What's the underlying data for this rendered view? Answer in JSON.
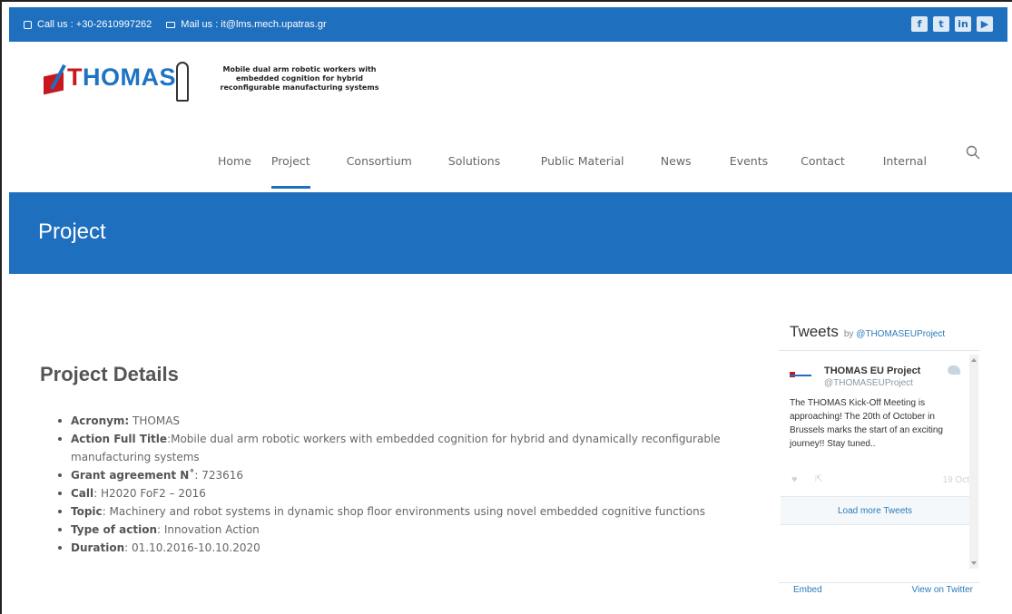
{
  "topbar": {
    "phone": "Call us : +30-2610997262",
    "mail": "Mail us : it@lms.mech.upatras.gr",
    "social": [
      "facebook-icon",
      "twitter-icon",
      "linkedin-icon",
      "youtube-icon"
    ]
  },
  "logo": {
    "word": "HOMAS",
    "tagline": "Mobile dual arm robotic workers with embedded cognition for hybrid reconfigurable manufacturing systems"
  },
  "nav": {
    "items": [
      "Home",
      "Project",
      "Consortium",
      "Solutions",
      "Public Material",
      "News",
      "Events",
      "Contact",
      "Internal"
    ],
    "active": "Project"
  },
  "page": {
    "title": "Project",
    "details_heading": "Project Details"
  },
  "details": [
    {
      "label": "Acronym:",
      "value": " THOMAS"
    },
    {
      "label": "Action Full Title",
      "value": ":Mobile dual arm robotic workers with embedded cognition for hybrid and dynamically reconfigurable manufacturing systems"
    },
    {
      "label": "Grant agreement N˚",
      "value": ": 723616"
    },
    {
      "label": "Call",
      "value": ": H2020 FoF2 – 2016"
    },
    {
      "label": "Topic",
      "value": ": Machinery and robot systems in dynamic shop floor environments using novel embedded cognitive functions"
    },
    {
      "label": "Type of action",
      "value": ": Innovation Action"
    },
    {
      "label": "Duration",
      "value": ": 01.10.2016-10.10.2020"
    }
  ],
  "tweets": {
    "heading": "Tweets",
    "by": "by ",
    "handle_link": "@THOMASEUProject",
    "author": "THOMAS EU Project",
    "author_handle": "@THOMASEUProject",
    "text": "The THOMAS Kick-Off Meeting is approaching! The 20th of October in Brussels marks the start of an exciting journey!! Stay tuned..",
    "date": "19 Oct",
    "load_more": "Load more Tweets",
    "embed": "Embed",
    "view": "View on Twitter"
  },
  "colors": {
    "primary_blue": "#1f6fbf",
    "logo_red": "#c8181e",
    "twitter_link": "#2b7bb9"
  }
}
